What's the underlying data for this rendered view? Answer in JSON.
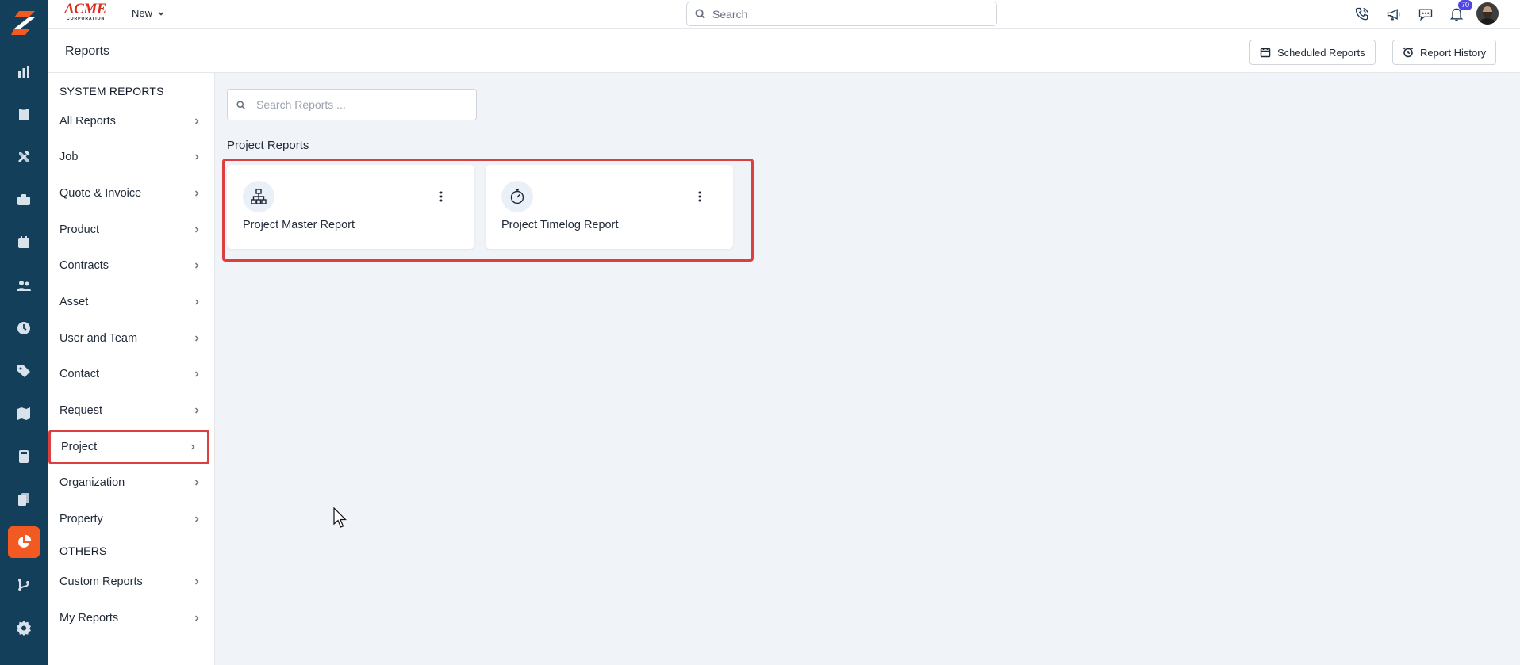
{
  "topbar": {
    "brand": "ACME",
    "brand_sub": "CORPORATION",
    "new_label": "New",
    "search_placeholder": "Search",
    "notification_count": "70"
  },
  "header": {
    "title": "Reports",
    "scheduled_label": "Scheduled Reports",
    "history_label": "Report History"
  },
  "sidebar": {
    "system_title": "SYSTEM REPORTS",
    "system_items": [
      {
        "label": "All Reports"
      },
      {
        "label": "Job"
      },
      {
        "label": "Quote & Invoice"
      },
      {
        "label": "Product"
      },
      {
        "label": "Contracts"
      },
      {
        "label": "Asset"
      },
      {
        "label": "User and Team"
      },
      {
        "label": "Contact"
      },
      {
        "label": "Request"
      },
      {
        "label": "Project"
      },
      {
        "label": "Organization"
      },
      {
        "label": "Property"
      }
    ],
    "others_title": "OTHERS",
    "other_items": [
      {
        "label": "Custom Reports"
      },
      {
        "label": "My Reports"
      }
    ]
  },
  "main": {
    "search_placeholder": "Search Reports ...",
    "group_title": "Project Reports",
    "cards": [
      {
        "title": "Project Master Report",
        "icon": "sitemap-icon"
      },
      {
        "title": "Project Timelog Report",
        "icon": "timer-icon"
      }
    ]
  },
  "colors": {
    "rail": "#143f5a",
    "accent": "#f25a22",
    "highlight": "#dc3f3f"
  }
}
